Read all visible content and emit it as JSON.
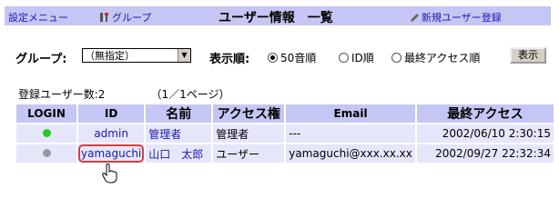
{
  "topbar": {
    "settings_menu": "設定メニュー",
    "group": "グループ",
    "title": "ユーザー情報　一覧",
    "new_user": "新規ユーザー登録"
  },
  "filter": {
    "group_label": "グループ:",
    "group_value": "（無指定）",
    "order_label": "表示順:",
    "options": [
      "50音順",
      "ID順",
      "最終アクセス順"
    ],
    "selected": "50音順",
    "show_button": "表示"
  },
  "summary": {
    "count": "登録ユーザー数:2",
    "pages": "（1／1ページ）"
  },
  "table": {
    "headers": [
      "LOGIN",
      "ID",
      "名前",
      "アクセス権",
      "Email",
      "最終アクセス"
    ],
    "rows": [
      {
        "status": "online",
        "id": "admin",
        "name": "管理者",
        "role": "管理者",
        "email": "---",
        "last_access": "2002/06/10 2:30:15"
      },
      {
        "status": "offline",
        "id": "yamaguchi",
        "name": "山口　太郎",
        "role": "ユーザー",
        "email": "yamaguchi@xxx.xx.xx",
        "last_access": "2002/09/27 22:32:34"
      }
    ]
  },
  "colors": {
    "header_bg": "#c6c6f5",
    "row_bg": "#e6e6fa",
    "link": "#1a1ab0",
    "online": "#22cc22",
    "offline": "#999999",
    "highlight": "#d04040"
  }
}
